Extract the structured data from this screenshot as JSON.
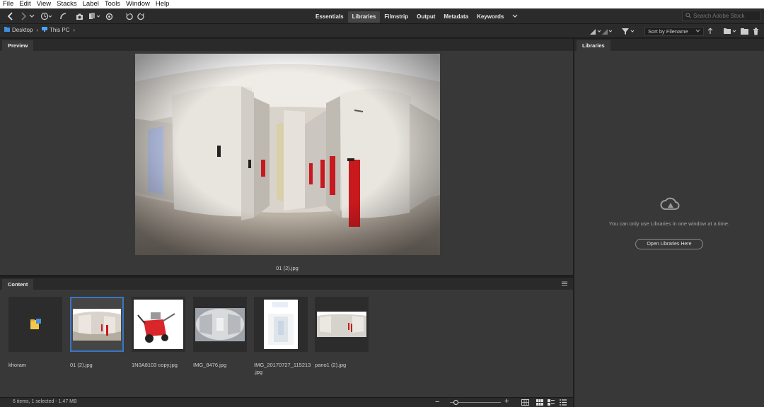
{
  "menu": [
    "File",
    "Edit",
    "View",
    "Stacks",
    "Label",
    "Tools",
    "Window",
    "Help"
  ],
  "workspaces": [
    {
      "label": "Essentials",
      "active": false
    },
    {
      "label": "Libraries",
      "active": true
    },
    {
      "label": "Filmstrip",
      "active": false
    },
    {
      "label": "Output",
      "active": false
    },
    {
      "label": "Metadata",
      "active": false
    },
    {
      "label": "Keywords",
      "active": false
    }
  ],
  "search": {
    "placeholder": "Search Adobe Stock"
  },
  "path": {
    "crumbs": [
      "Desktop",
      "This PC"
    ]
  },
  "sort": {
    "label": "Sort by Filename"
  },
  "preview": {
    "tab": "Preview",
    "caption": "01 (2).jpg"
  },
  "content": {
    "tab": "Content",
    "items": [
      {
        "name": "khoram",
        "kind": "folder",
        "selected": false
      },
      {
        "name": "01 (2).jpg",
        "kind": "pano",
        "selected": true
      },
      {
        "name": "1N0A8103 copy.jpg",
        "kind": "machine",
        "selected": false
      },
      {
        "name": "IMG_8476.jpg",
        "kind": "fisheye",
        "selected": false
      },
      {
        "name": "IMG_20170727_115213.jpg",
        "name_line1": "IMG_20170727_115213",
        "name_line2": ".jpg",
        "kind": "portrait",
        "selected": false
      },
      {
        "name": "pano1 (2).jpg",
        "kind": "pano2",
        "selected": false
      }
    ]
  },
  "status": {
    "text": "6 items, 1 selected - 1.47 MB",
    "zoom_fraction": 0.12
  },
  "libraries": {
    "tab": "Libraries",
    "message": "You can only use Libraries in one window at a time.",
    "button": "Open Libraries Here"
  },
  "colors": {
    "accent": "#3a75c4",
    "panel": "#383838",
    "red_handle": "#c8191e"
  }
}
